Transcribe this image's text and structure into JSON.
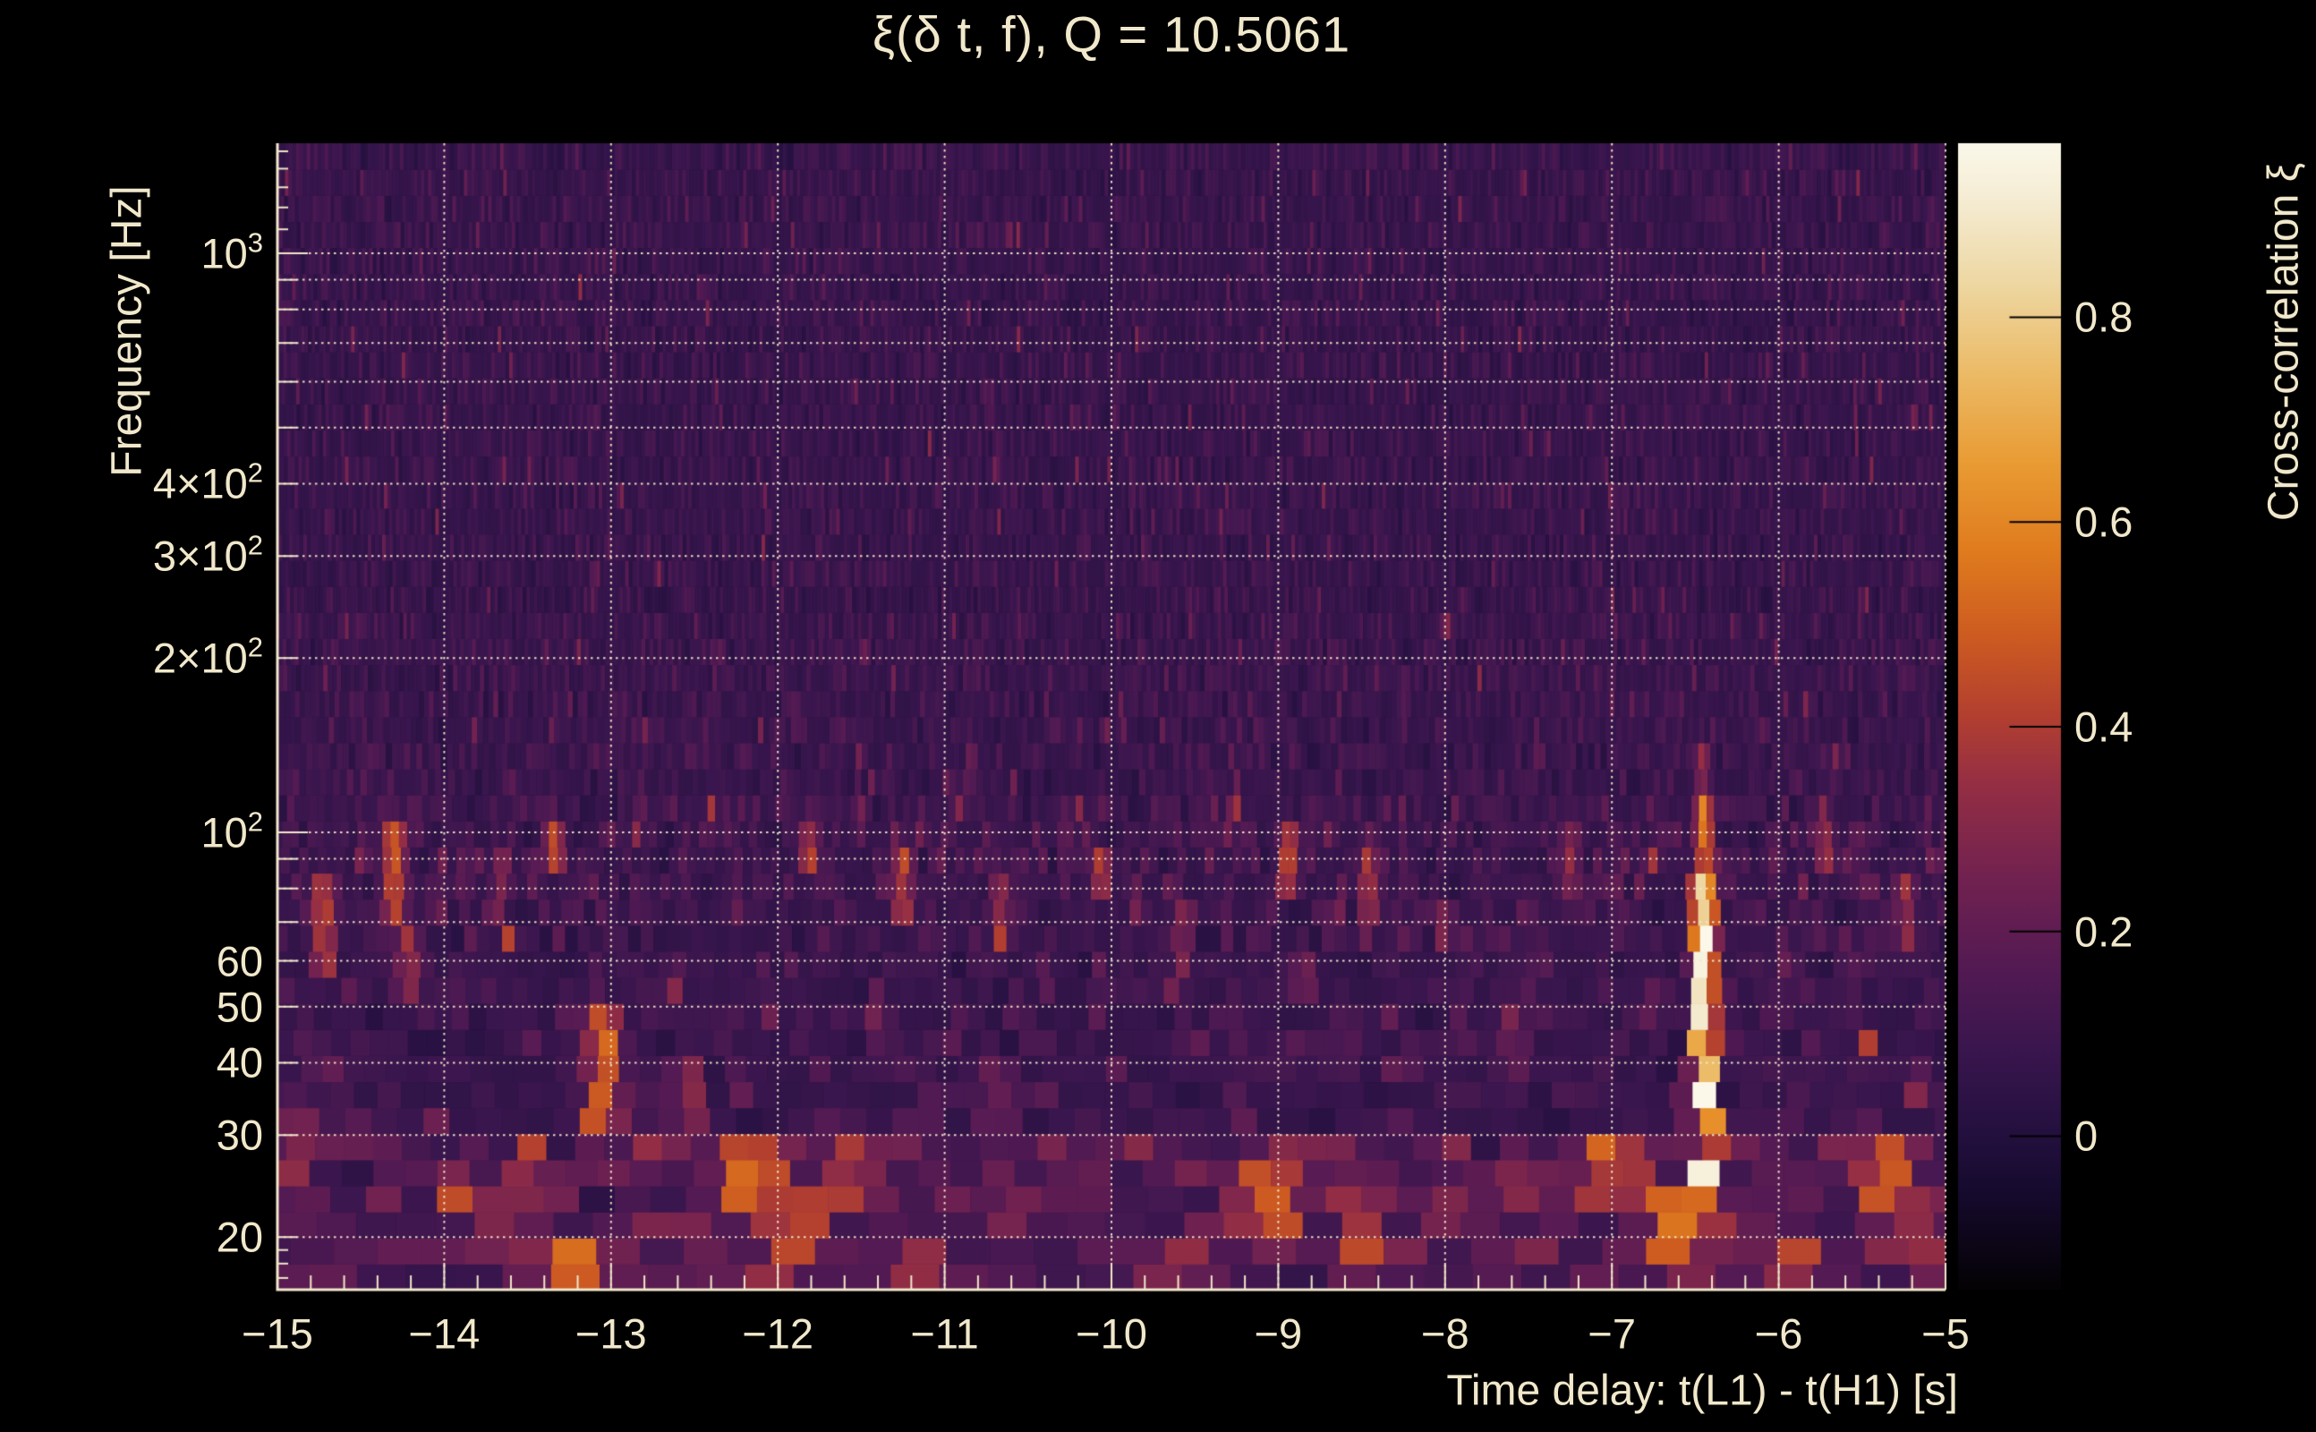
{
  "title": "ξ(δ t, f), Q = 10.5061",
  "colors": {
    "background": "#000000",
    "text": "#f1e8cb",
    "grid": "#f1e8cb",
    "axis": "#f1e8cb",
    "colorbar_tick": "#000000"
  },
  "x_axis": {
    "title": "Time delay: t(L1) - t(H1) [s]",
    "min": -15,
    "max": -5,
    "minor_step": 0.2,
    "ticks": [
      {
        "v": -15,
        "label": "−15"
      },
      {
        "v": -14,
        "label": "−14"
      },
      {
        "v": -13,
        "label": "−13"
      },
      {
        "v": -12,
        "label": "−12"
      },
      {
        "v": -11,
        "label": "−11"
      },
      {
        "v": -10,
        "label": "−10"
      },
      {
        "v": -9,
        "label": "−9"
      },
      {
        "v": -8,
        "label": "−8"
      },
      {
        "v": -7,
        "label": "−7"
      },
      {
        "v": -6,
        "label": "−6"
      },
      {
        "v": -5,
        "label": "−5"
      }
    ]
  },
  "y_axis": {
    "title": "Frequency [Hz]",
    "scale": "log",
    "min_hz": 16.2,
    "max_hz": 1549,
    "ticks": [
      {
        "v": 1000,
        "base": "10",
        "sup": "3"
      },
      {
        "v": 400,
        "base": "4×10",
        "sup": "2"
      },
      {
        "v": 300,
        "base": "3×10",
        "sup": "2"
      },
      {
        "v": 200,
        "base": "2×10",
        "sup": "2"
      },
      {
        "v": 100,
        "base": "10",
        "sup": "2"
      },
      {
        "v": 60,
        "base": "60",
        "sup": ""
      },
      {
        "v": 50,
        "base": "50",
        "sup": ""
      },
      {
        "v": 40,
        "base": "40",
        "sup": ""
      },
      {
        "v": 30,
        "base": "30",
        "sup": ""
      },
      {
        "v": 20,
        "base": "20",
        "sup": ""
      }
    ],
    "gridline_freqs": [
      20,
      30,
      40,
      50,
      60,
      70,
      80,
      90,
      100,
      200,
      300,
      400,
      500,
      600,
      700,
      800,
      900,
      1000
    ],
    "minor_tick_freqs": [
      16,
      17,
      18,
      19,
      1100,
      1200,
      1300,
      1400,
      1500
    ]
  },
  "colorbar": {
    "title": "Cross-correlation ξ",
    "min": -0.15,
    "max": 0.97,
    "ticks": [
      {
        "v": 0.8,
        "label": "0.8"
      },
      {
        "v": 0.6,
        "label": "0.6"
      },
      {
        "v": 0.4,
        "label": "0.4"
      },
      {
        "v": 0.2,
        "label": "0.2"
      },
      {
        "v": 0.0,
        "label": "0"
      }
    ],
    "stops": [
      [
        0.0,
        "#040204"
      ],
      [
        0.09,
        "#170b30"
      ],
      [
        0.145,
        "#261141"
      ],
      [
        0.21,
        "#3a164e"
      ],
      [
        0.28,
        "#531a53"
      ],
      [
        0.36,
        "#722250"
      ],
      [
        0.44,
        "#942e44"
      ],
      [
        0.5,
        "#b23f30"
      ],
      [
        0.57,
        "#cd5b21"
      ],
      [
        0.645,
        "#e07c1e"
      ],
      [
        0.72,
        "#e99b33"
      ],
      [
        0.8,
        "#ecbb67"
      ],
      [
        0.88,
        "#eed8a4"
      ],
      [
        0.95,
        "#f5ecd3"
      ],
      [
        1.0,
        "#fbf8ea"
      ]
    ]
  },
  "chart_data": {
    "type": "heatmap",
    "title": "ξ(δ t, f), Q = 10.5061",
    "q_value": 10.5061,
    "xlabel": "Time delay: t(L1) - t(H1) [s]",
    "ylabel": "Frequency [Hz]",
    "xlim": [
      -15,
      -5
    ],
    "ylim_hz": [
      16.2,
      1549
    ],
    "y_scale": "log",
    "color_scale": {
      "label": "Cross-correlation ξ",
      "range": [
        -0.15,
        0.97
      ],
      "ticks": [
        0,
        0.2,
        0.4,
        0.6,
        0.8
      ]
    },
    "grid": "dotted cream lines at integer seconds and log-spaced frequencies",
    "legend_position": "right colorbar",
    "background_xi_typical": [
      0.0,
      0.15
    ],
    "main_peak": {
      "time_delay_s": -6.45,
      "freq_range_hz": [
        21,
        135
      ],
      "core_freq_range_hz": [
        26,
        82
      ],
      "peak_xi": 0.95
    },
    "features": [
      {
        "t": -6.45,
        "f0": 26,
        "f1": 82,
        "xi": 0.95,
        "dt": 0.11
      },
      {
        "t": -6.45,
        "f0": 82,
        "f1": 112,
        "xi": 0.55,
        "dt": 0.09
      },
      {
        "t": -6.45,
        "f0": 21,
        "f1": 26,
        "xi": 0.6,
        "dt": 0.14
      },
      {
        "t": -6.46,
        "f0": 112,
        "f1": 135,
        "xi": 0.32,
        "dt": 0.08
      },
      {
        "t": -14.72,
        "f0": 62,
        "f1": 80,
        "xi": 0.42,
        "dt": 0.12
      },
      {
        "t": -14.9,
        "f0": 23,
        "f1": 30,
        "xi": 0.32,
        "dt": 0.2
      },
      {
        "t": -14.3,
        "f0": 72,
        "f1": 95,
        "xi": 0.45,
        "dt": 0.12
      },
      {
        "t": -14.22,
        "f0": 54,
        "f1": 64,
        "xi": 0.35,
        "dt": 0.12
      },
      {
        "t": -13.66,
        "f0": 80,
        "f1": 92,
        "xi": 0.3,
        "dt": 0.1
      },
      {
        "t": -13.34,
        "f0": 88,
        "f1": 102,
        "xi": 0.42,
        "dt": 0.1
      },
      {
        "t": -13.05,
        "f0": 34,
        "f1": 48,
        "xi": 0.5,
        "dt": 0.18
      },
      {
        "t": -12.55,
        "f0": 30,
        "f1": 38,
        "xi": 0.32,
        "dt": 0.16
      },
      {
        "t": -11.81,
        "f0": 88,
        "f1": 100,
        "xi": 0.38,
        "dt": 0.1
      },
      {
        "t": -11.25,
        "f0": 74,
        "f1": 88,
        "xi": 0.4,
        "dt": 0.1
      },
      {
        "t": -10.66,
        "f0": 68,
        "f1": 80,
        "xi": 0.36,
        "dt": 0.1
      },
      {
        "t": -10.07,
        "f0": 80,
        "f1": 92,
        "xi": 0.38,
        "dt": 0.1
      },
      {
        "t": -9.58,
        "f0": 60,
        "f1": 70,
        "xi": 0.3,
        "dt": 0.1
      },
      {
        "t": -8.94,
        "f0": 86,
        "f1": 100,
        "xi": 0.42,
        "dt": 0.1
      },
      {
        "t": -8.46,
        "f0": 74,
        "f1": 86,
        "xi": 0.36,
        "dt": 0.1
      },
      {
        "t": -8.0,
        "f0": 64,
        "f1": 74,
        "xi": 0.3,
        "dt": 0.1
      },
      {
        "t": -7.25,
        "f0": 84,
        "f1": 96,
        "xi": 0.3,
        "dt": 0.1
      },
      {
        "t": -5.72,
        "f0": 90,
        "f1": 102,
        "xi": 0.32,
        "dt": 0.1
      },
      {
        "t": -5.24,
        "f0": 70,
        "f1": 82,
        "xi": 0.34,
        "dt": 0.1
      },
      {
        "t": -13.26,
        "f0": 16,
        "f1": 18.5,
        "xi": 0.5,
        "dt": 0.35
      },
      {
        "t": -13.6,
        "f0": 20,
        "f1": 24,
        "xi": 0.35,
        "dt": 0.3
      },
      {
        "t": -12.15,
        "f0": 23,
        "f1": 28,
        "xi": 0.5,
        "dt": 0.4
      },
      {
        "t": -11.9,
        "f0": 20,
        "f1": 23,
        "xi": 0.45,
        "dt": 0.35
      },
      {
        "t": -11.55,
        "f0": 24,
        "f1": 27,
        "xi": 0.4,
        "dt": 0.3
      },
      {
        "t": -11.2,
        "f0": 17,
        "f1": 19.5,
        "xi": 0.35,
        "dt": 0.3
      },
      {
        "t": -10.6,
        "f0": 21,
        "f1": 24,
        "xi": 0.3,
        "dt": 0.3
      },
      {
        "t": -9.6,
        "f0": 16,
        "f1": 18,
        "xi": 0.35,
        "dt": 0.3
      },
      {
        "t": -9.05,
        "f0": 22,
        "f1": 26,
        "xi": 0.48,
        "dt": 0.35
      },
      {
        "t": -8.5,
        "f0": 19,
        "f1": 22,
        "xi": 0.4,
        "dt": 0.3
      },
      {
        "t": -7.05,
        "f0": 23,
        "f1": 27,
        "xi": 0.45,
        "dt": 0.3
      },
      {
        "t": -6.85,
        "f0": 24,
        "f1": 27,
        "xi": 0.4,
        "dt": 0.25
      },
      {
        "t": -6.65,
        "f0": 19,
        "f1": 23,
        "xi": 0.5,
        "dt": 0.3
      },
      {
        "t": -5.85,
        "f0": 16,
        "f1": 18.5,
        "xi": 0.4,
        "dt": 0.3
      },
      {
        "t": -5.35,
        "f0": 25,
        "f1": 29,
        "xi": 0.5,
        "dt": 0.3
      },
      {
        "t": -5.12,
        "f0": 20,
        "f1": 23,
        "xi": 0.4,
        "dt": 0.25
      },
      {
        "t": -10.7,
        "f0": 33,
        "f1": 38,
        "xi": 0.25,
        "dt": 0.2
      },
      {
        "t": -8.85,
        "f0": 52,
        "f1": 58,
        "xi": 0.25,
        "dt": 0.15
      },
      {
        "t": -7.6,
        "f0": 42,
        "f1": 48,
        "xi": 0.25,
        "dt": 0.15
      }
    ]
  }
}
